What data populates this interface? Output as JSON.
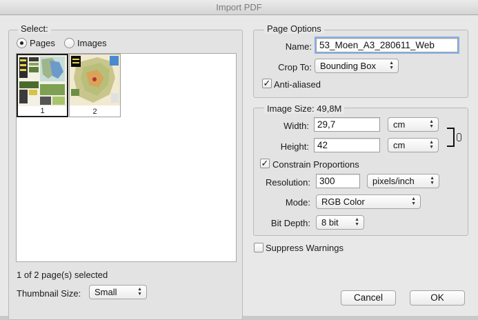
{
  "window": {
    "title": "Import PDF"
  },
  "select": {
    "title": "Select:",
    "pages_label": "Pages",
    "images_label": "Images",
    "pages": [
      {
        "number": "1"
      },
      {
        "number": "2"
      }
    ],
    "status": "1 of 2 page(s) selected",
    "thumb_size_label": "Thumbnail Size:",
    "thumb_size_value": "Small"
  },
  "page_options": {
    "title": "Page Options",
    "name_label": "Name:",
    "name_value": "53_Moen_A3_280611_Web",
    "crop_label": "Crop To:",
    "crop_value": "Bounding Box",
    "antialias_label": "Anti-aliased"
  },
  "image_size": {
    "title": "Image Size: 49,8M",
    "width_label": "Width:",
    "width_value": "29,7",
    "width_unit": "cm",
    "height_label": "Height:",
    "height_value": "42",
    "height_unit": "cm",
    "constrain_label": "Constrain Proportions",
    "resolution_label": "Resolution:",
    "resolution_value": "300",
    "resolution_unit": "pixels/inch",
    "mode_label": "Mode:",
    "mode_value": "RGB Color",
    "bitdepth_label": "Bit Depth:",
    "bitdepth_value": "8 bit"
  },
  "suppress_label": "Suppress Warnings",
  "buttons": {
    "cancel": "Cancel",
    "ok": "OK"
  }
}
